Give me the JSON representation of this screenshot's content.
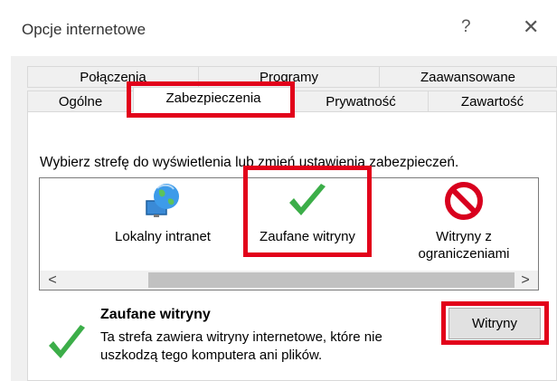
{
  "window": {
    "title": "Opcje internetowe",
    "help_glyph": "?",
    "close_glyph": "✕"
  },
  "tabs": {
    "row1": [
      "Połączenia",
      "Programy",
      "Zaawansowane"
    ],
    "row2": [
      "Ogólne",
      "Zabezpieczenia",
      "Prywatność",
      "Zawartość"
    ],
    "active": "Zabezpieczenia"
  },
  "security": {
    "instruction": "Wybierz strefę do wyświetlenia lub zmień ustawienia zabezpieczeń.",
    "zones": [
      {
        "label": "Lokalny intranet",
        "icon": "globe-monitor-icon"
      },
      {
        "label": "Zaufane witryny",
        "icon": "checkmark-icon"
      },
      {
        "label_line1": "Witryny z",
        "label_line2": "ograniczeniami",
        "icon": "restricted-icon"
      }
    ],
    "scroll_left": "<",
    "scroll_right": ">",
    "selected_zone": {
      "title": "Zaufane witryny",
      "description": "Ta strefa zawiera witryny internetowe, które nie uszkodzą tego komputera ani plików."
    },
    "sites_button": "Witryny"
  },
  "colors": {
    "highlight": "#e2001a",
    "dialog_bg": "#f0f0f0",
    "check_green": "#3cae49",
    "restricted_red": "#d8001e"
  }
}
